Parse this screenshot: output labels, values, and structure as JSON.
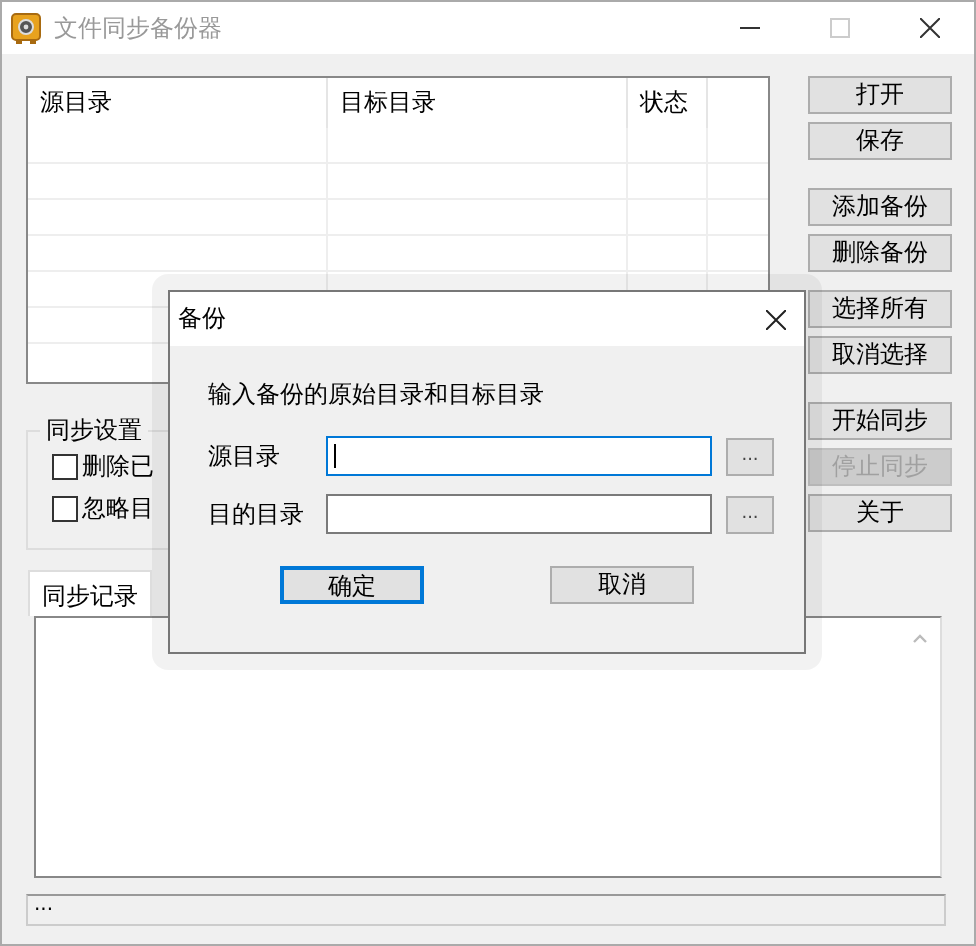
{
  "window": {
    "title": "文件同步备份器",
    "active": false
  },
  "table": {
    "columns": [
      "源目录",
      "目标目录",
      "状态"
    ]
  },
  "button_groups": [
    [
      {
        "label": "打开",
        "disabled": false
      },
      {
        "label": "保存",
        "disabled": false
      }
    ],
    [
      {
        "label": "添加备份",
        "disabled": false
      },
      {
        "label": "删除备份",
        "disabled": false
      },
      {
        "label": "选择所有",
        "disabled": false
      },
      {
        "label": "取消选择",
        "disabled": false
      }
    ],
    [
      {
        "label": "开始同步",
        "disabled": false
      },
      {
        "label": "停止同步",
        "disabled": true
      },
      {
        "label": "关于",
        "disabled": false
      }
    ]
  ],
  "sync_settings": {
    "title": "同步设置",
    "options": [
      {
        "label": "删除已",
        "checked": false
      },
      {
        "label": "忽略目",
        "checked": false
      }
    ]
  },
  "log_tabs": [
    {
      "label": "同步记录",
      "selected": true
    }
  ],
  "status_bar": "...",
  "dialog": {
    "title": "备份",
    "prompt": "输入备份的原始目录和目标目录",
    "fields": [
      {
        "label": "源目录",
        "focused": true,
        "browse": "..."
      },
      {
        "label": "目的目录",
        "focused": false,
        "browse": "..."
      }
    ],
    "buttons": [
      {
        "label": "确定",
        "default": true
      },
      {
        "label": "取消",
        "default": false
      }
    ]
  }
}
